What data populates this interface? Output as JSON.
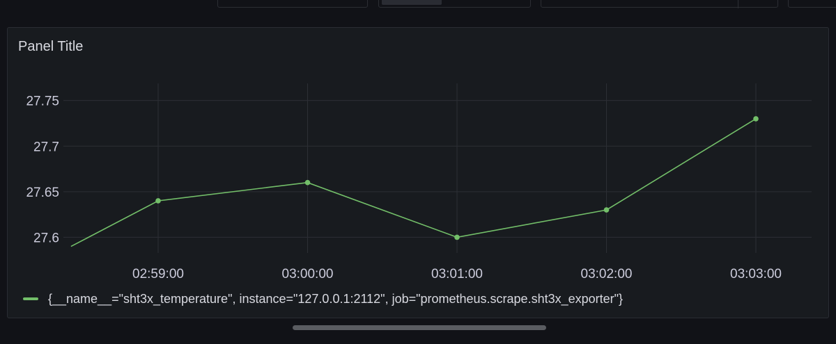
{
  "panel": {
    "title": "Panel Title"
  },
  "colors": {
    "series": "#73bf69",
    "grid": "#2c2f35",
    "panel_bg": "#181b1f",
    "page_bg": "#111217"
  },
  "chart_data": {
    "type": "line",
    "title": "Panel Title",
    "xlabel": "",
    "ylabel": "",
    "ylim": [
      27.5828,
      27.7688
    ],
    "y_ticks": [
      "27.6",
      "27.65",
      "27.7",
      "27.75"
    ],
    "x_ticks": [
      "02:59:00",
      "03:00:00",
      "03:01:00",
      "03:02:00",
      "03:03:00"
    ],
    "grid": true,
    "legend_position": "bottom",
    "series": [
      {
        "name": "{__name__=\"sht3x_temperature\", instance=\"127.0.0.1:2112\", job=\"prometheus.scrape.sht3x_exporter\"}",
        "x": [
          "02:58:25",
          "02:59:00",
          "03:00:00",
          "03:01:00",
          "03:02:00",
          "03:03:00"
        ],
        "values": [
          27.59,
          27.64,
          27.66,
          27.6,
          27.63,
          27.73
        ]
      }
    ]
  }
}
